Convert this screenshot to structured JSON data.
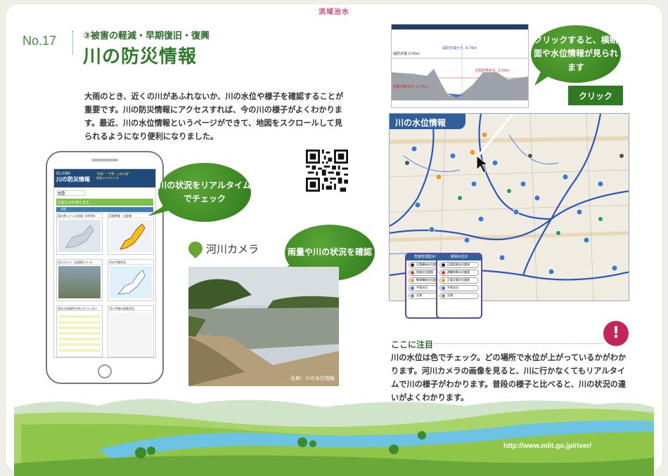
{
  "header": {
    "banner": "流域治水"
  },
  "article": {
    "number": "No.17",
    "subtitle": "③被害の軽減・早期復旧・復興",
    "title": "川の防災情報",
    "body": "大雨のとき、近くの川があふれないか、川の水位や様子を確認することが重要です。川の防災情報にアクセスすれば、今の川の様子がよくわかります。最近、川の水位情報というページができて、地図をスクロールして見られるようになり便利になりました。"
  },
  "phone": {
    "agency": "国土交通省",
    "app_title": "川の防災情報",
    "nav_text": "\"気象\"・\"予警・土砂災害\"",
    "nav_text2": "情報マルチモニタ",
    "select": "全国",
    "notice": "お知らせがあります。",
    "tab": "全国",
    "cards": [
      "雨の降っている地域（XRAIN）",
      "気象警報・注意報",
      "河川カメラ（全国版カメラ）",
      "洪水予報状況",
      "浸水の危険性を知らせている川",
      "河川予報の発表状況"
    ]
  },
  "bubbles": {
    "phone_check": "川の状況をリアルタイムでチェック",
    "rain_check": "雨量や川の状況を確認",
    "click_info": "クリックすると、横断面や水位情報が見られます"
  },
  "camera": {
    "title": "河川カメラ",
    "credit": "出典：川の水位情報"
  },
  "cross_section": {
    "label_top": "堤防天端から -6.76m",
    "label_left": "堤防天端 0.00m",
    "label_right": "氾濫危険水位 -2.50m",
    "label_warn": "避難判断水位 -2.79m"
  },
  "map": {
    "tag": "川の水位情報",
    "click": "クリック",
    "legend_left": {
      "header": "危機管理型水位計",
      "items": [
        "氾濫開始水位超過",
        "危険水位超過",
        "観測開始水位超過",
        "平常水位",
        "欠測"
      ]
    },
    "legend_right": {
      "header": "通常水位計",
      "items": [
        "氾濫危険水位超過",
        "避難判断水位超過",
        "氾濫注意水位超過",
        "平常水位",
        "欠測"
      ]
    }
  },
  "note": {
    "title": "ここに注目",
    "badge": "!",
    "body": "川の水位は色でチェック。どの場所で水位が上がっているかがわかります。河川カメラの画像を見ると、川に行かなくてもリアルタイムで川の様子がわかります。普段の様子と比べると、川の状況の違いがよくわかります。"
  },
  "footer": {
    "url": "http://www.mlit.go.jp/river/"
  },
  "colors": {
    "accent_green": "#2e7b2a",
    "bubble_green": "#3f8d25",
    "badge_pink": "#c5245a",
    "map_blue": "#2f5f9c"
  }
}
